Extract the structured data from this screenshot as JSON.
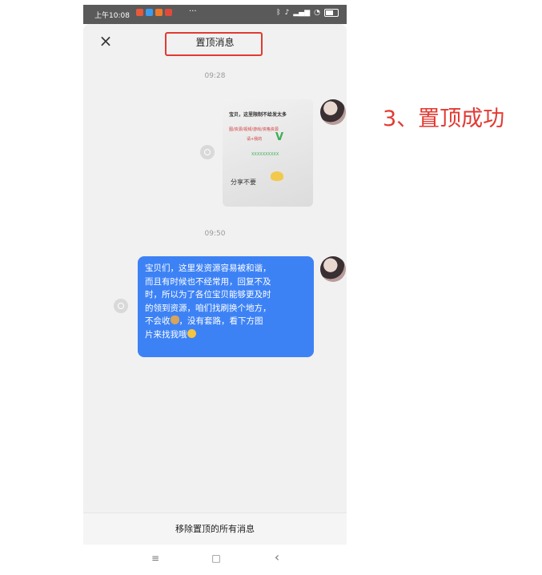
{
  "status_bar": {
    "time": "上午10:08",
    "dots": "···",
    "app_icon_colors": [
      "#e85a3c",
      "#3d9cf0",
      "#f07a2a",
      "#e04a3a"
    ],
    "sys_icons": [
      "bluetooth-icon",
      "vibrate-icon",
      "signal-icon",
      "signal-icon",
      "wifi-icon",
      "battery-icon"
    ]
  },
  "header": {
    "close_icon": "×",
    "title": "置顶消息"
  },
  "messages": [
    {
      "timestamp": "09:28",
      "type": "image",
      "image_text": {
        "line1": "宝贝，这里限制不给发太多",
        "line2": "图/资源/视频/游戏/资格资源",
        "line3": "请+我的",
        "mark": "V",
        "line4": "XXXXXXXXXX",
        "caption": "分享不要"
      }
    },
    {
      "timestamp": "09:50",
      "type": "text",
      "lines": [
        "宝贝们，这里发资源容易被和谐，",
        "而且有时候也不经常用，回复不及",
        "时，所以为了各位宝贝能够更及时",
        "的领到资源，咱们找刷换个地方，",
        [
          "不会收",
          "，没有套路，看下方图"
        ],
        [
          "片来找我哦",
          ""
        ]
      ]
    }
  ],
  "bottom_action": {
    "label": "移除置顶的所有消息"
  },
  "nav": {
    "menu": "≡",
    "home": "□",
    "back": "‹"
  },
  "annotation": {
    "text": "3、置顶成功"
  },
  "colors": {
    "accent_red": "#e23a32",
    "bubble_blue": "#3d82f5",
    "chat_bg": "#f1f1f1"
  }
}
